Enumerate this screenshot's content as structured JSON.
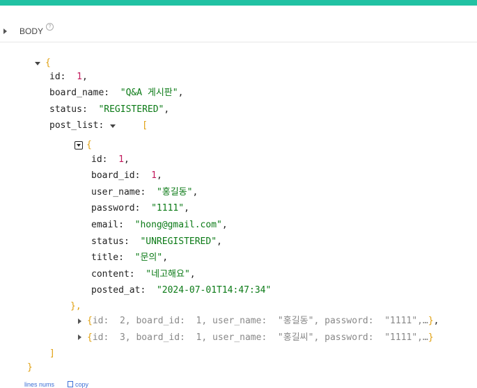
{
  "section": {
    "title": "BODY",
    "help": "?"
  },
  "json": {
    "open_brace": "{",
    "close_brace": "}",
    "id_key": "id:",
    "id_val": "1",
    "board_name_key": "board_name:",
    "board_name_val": "\"Q&A 게시판\"",
    "status_key": "status:",
    "status_val": "\"REGISTERED\"",
    "post_list_key": "post_list:",
    "open_bracket": "[",
    "close_bracket": "]",
    "post": {
      "open": "{",
      "close": "},",
      "id_key": "id:",
      "id_val": "1",
      "board_id_key": "board_id:",
      "board_id_val": "1",
      "user_name_key": "user_name:",
      "user_name_val": "\"홍길동\"",
      "password_key": "password:",
      "password_val": "\"1111\"",
      "email_key": "email:",
      "email_val": "\"hong@gmail.com\"",
      "status_key": "status:",
      "status_val": "\"UNREGISTERED\"",
      "title_key": "title:",
      "title_val": "\"문의\"",
      "content_key": "content:",
      "content_val": "\"네고해요\"",
      "posted_at_key": "posted_at:",
      "posted_at_val": "\"2024-07-01T14:47:34\""
    },
    "collapsed": [
      {
        "text": "id:  2, board_id:  1, user_name:  \"홍길동\", password:  \"1111\",…"
      },
      {
        "text": "id:  3, board_id:  1, user_name:  \"홍길씨\", password:  \"1111\",…"
      }
    ]
  },
  "footer": {
    "lines_nums": "lines nums",
    "copy": "copy"
  }
}
